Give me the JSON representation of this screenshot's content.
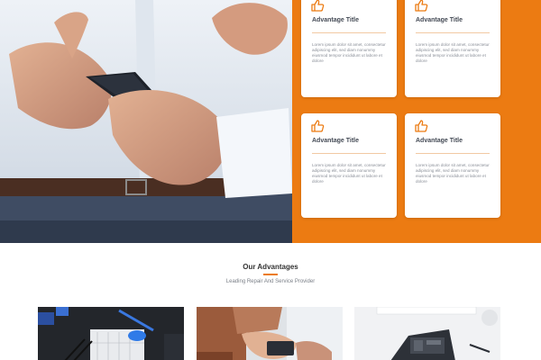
{
  "advantages_cards": [
    {
      "icon": "thumbs-up-icon",
      "title": "Advantage Title",
      "text": "Lorem ipsum dolor sit amet, consectetur adipiscing elit, sed diam nonummy eiusmod tempor incididunt ut labore et dolore"
    },
    {
      "icon": "thumbs-up-icon",
      "title": "Advantage Title",
      "text": "Lorem ipsum dolor sit amet, consectetur adipiscing elit, sed diam nonummy eiusmod tempor incididunt ut labore et dolore"
    },
    {
      "icon": "thumbs-up-icon",
      "title": "Advantage Title",
      "text": "Lorem ipsum dolor sit amet, consectetur adipiscing elit, sed diam nonummy eiusmod tempor incididunt ut labore et dolore"
    },
    {
      "icon": "thumbs-up-icon",
      "title": "Advantage Title",
      "text": "Lorem ipsum dolor sit amet, consectetur adipiscing elit, sed diam nonummy eiusmod tempor incididunt ut labore et dolore"
    }
  ],
  "section": {
    "title": "Our Advantages",
    "subtitle": "Leading Repair And Service Provider"
  },
  "colors": {
    "accent": "#ec7b12",
    "card_background": "#ffffff",
    "title_text": "#444a55",
    "body_text": "#8a8f98"
  }
}
